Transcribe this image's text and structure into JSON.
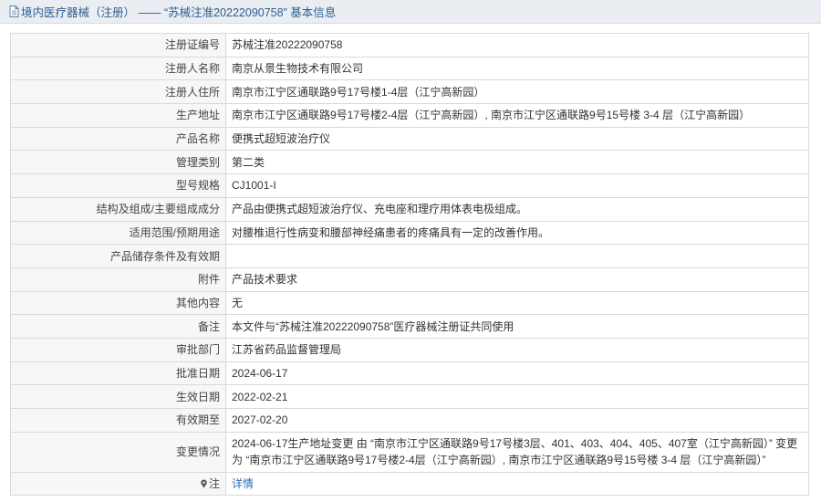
{
  "header": {
    "title": "境内医疗器械（注册） —— “苏械注准20222090758” 基本信息",
    "icon": "document-icon"
  },
  "rows": [
    {
      "label": "注册证编号",
      "value": "苏械注准20222090758"
    },
    {
      "label": "注册人名称",
      "value": "南京从景生物技术有限公司"
    },
    {
      "label": "注册人住所",
      "value": "南京市江宁区通联路9号17号楼1-4层（江宁高新园）"
    },
    {
      "label": "生产地址",
      "value": "南京市江宁区通联路9号17号楼2-4层（江宁高新园）, 南京市江宁区通联路9号15号楼 3-4 层（江宁高新园）"
    },
    {
      "label": "产品名称",
      "value": "便携式超短波治疗仪"
    },
    {
      "label": "管理类别",
      "value": "第二类"
    },
    {
      "label": "型号规格",
      "value": "CJ1001-I"
    },
    {
      "label": "结构及组成/主要组成成分",
      "value": "产品由便携式超短波治疗仪、充电座和理疗用体表电极组成。"
    },
    {
      "label": "适用范围/预期用途",
      "value": "对腰椎退行性病变和腰部神经痛患者的疼痛具有一定的改善作用。"
    },
    {
      "label": "产品储存条件及有效期",
      "value": ""
    },
    {
      "label": "附件",
      "value": "产品技术要求"
    },
    {
      "label": "其他内容",
      "value": "无"
    },
    {
      "label": "备注",
      "value": "本文件与“苏械注准20222090758”医疗器械注册证共同使用"
    },
    {
      "label": "审批部门",
      "value": "江苏省药品监督管理局"
    },
    {
      "label": "批准日期",
      "value": "2024-06-17"
    },
    {
      "label": "生效日期",
      "value": "2022-02-21"
    },
    {
      "label": "有效期至",
      "value": "2027-02-20"
    },
    {
      "label": "变更情况",
      "value": "2024-06-17生产地址变更 由 “南京市江宁区通联路9号17号楼3层、401、403、404、405、407室（江宁高新园）” 变更为 “南京市江宁区通联路9号17号楼2-4层（江宁高新园）, 南京市江宁区通联路9号15号楼 3-4 层（江宁高新园）”"
    }
  ],
  "note": {
    "label": "注",
    "icon": "pin-icon",
    "link_text": "详情"
  },
  "colors": {
    "title_bar_bg": "#eaeef3",
    "title_text": "#2b5d8f",
    "label_bg": "#f7f7f7",
    "border": "#d9d9d9",
    "link": "#2a6cb7"
  }
}
